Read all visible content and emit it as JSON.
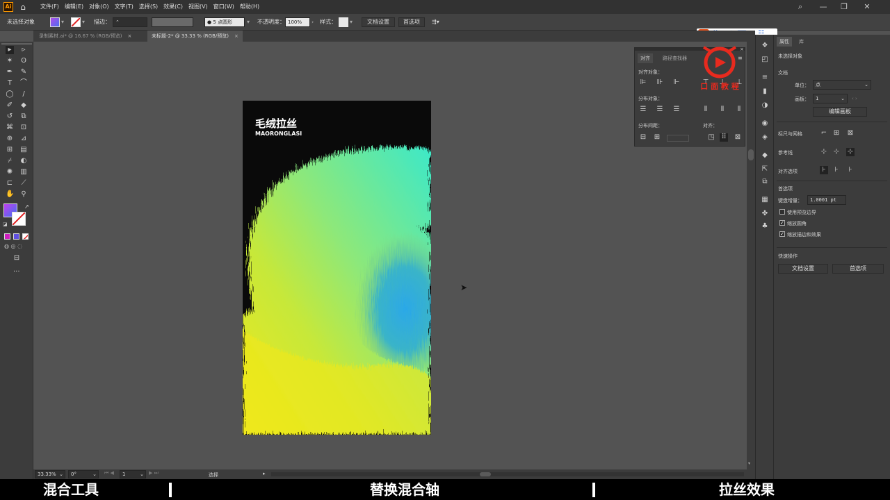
{
  "menubar": {
    "app_logo": "Ai",
    "home_icon": "home-icon",
    "menus": [
      "文件(F)",
      "编辑(E)",
      "对象(O)",
      "文字(T)",
      "选择(S)",
      "效果(C)",
      "视图(V)",
      "窗口(W)",
      "帮助(H)"
    ]
  },
  "control_bar": {
    "no_selection": "未选择对象",
    "fill_color": "#8a4df0",
    "stroke_label": "描边：",
    "brush_label": "5 点圆形",
    "opacity_label": "不透明度：",
    "opacity_value": "100%",
    "style_label": "样式：",
    "doc_setup_button": "文档设置",
    "preferences_button": "首选项"
  },
  "ime": {
    "logo": "S",
    "lang": "英"
  },
  "tabs": [
    {
      "label": "录制素材.ai* @ 16.67 % (RGB/预览)",
      "close": "×"
    },
    {
      "label": "未标题-2* @ 33.33 % (RGB/预览)",
      "close": "×"
    }
  ],
  "artboard": {
    "title": "毛绒拉丝",
    "subtitle": "MAORONGLASI",
    "colors": {
      "bg": "#0a0a0a",
      "yellow": "#f0e81a",
      "green": "#8de87a",
      "cyan": "#3de8c8",
      "blue": "#2ba8e8"
    }
  },
  "align_panel": {
    "tab_align": "对齐",
    "tab_pathfinder": "路径查找器",
    "align_objects": "对齐对象：",
    "distribute_objects": "分布对象：",
    "distribute_spacing": "分布间距：",
    "align_to": "对齐："
  },
  "watermark": {
    "text": "口 面 教 程"
  },
  "properties_panel": {
    "tab_properties": "属性",
    "tab_library": "库",
    "no_selection": "未选择对象",
    "document": "文档",
    "units_label": "单位：",
    "units_value": "点",
    "artboard_label": "画板：",
    "artboard_value": "1",
    "edit_artboards_button": "编辑画板",
    "rulers_grids": "标尺与网格",
    "guides": "参考线",
    "snap_options": "对齐选项",
    "preferences": "首选项",
    "keyboard_increment_label": "键盘增量：",
    "keyboard_increment_value": "1.0001 pt",
    "use_preview_bounds": "使用预览边界",
    "scale_corners": "缩放圆角",
    "scale_strokes_effects": "缩放描边和效果",
    "quick_actions": "快速操作",
    "doc_setup_button": "文档设置",
    "preferences_button": "首选项",
    "checkboxes": {
      "use_preview_bounds": false,
      "scale_corners": true,
      "scale_strokes_effects": true
    }
  },
  "statusbar": {
    "zoom": "33.33%",
    "rotation": "0°",
    "artboard_num": "1",
    "tool": "选择"
  },
  "captions": {
    "left": "混合工具",
    "middle": "替换混合轴",
    "right": "拉丝效果"
  }
}
